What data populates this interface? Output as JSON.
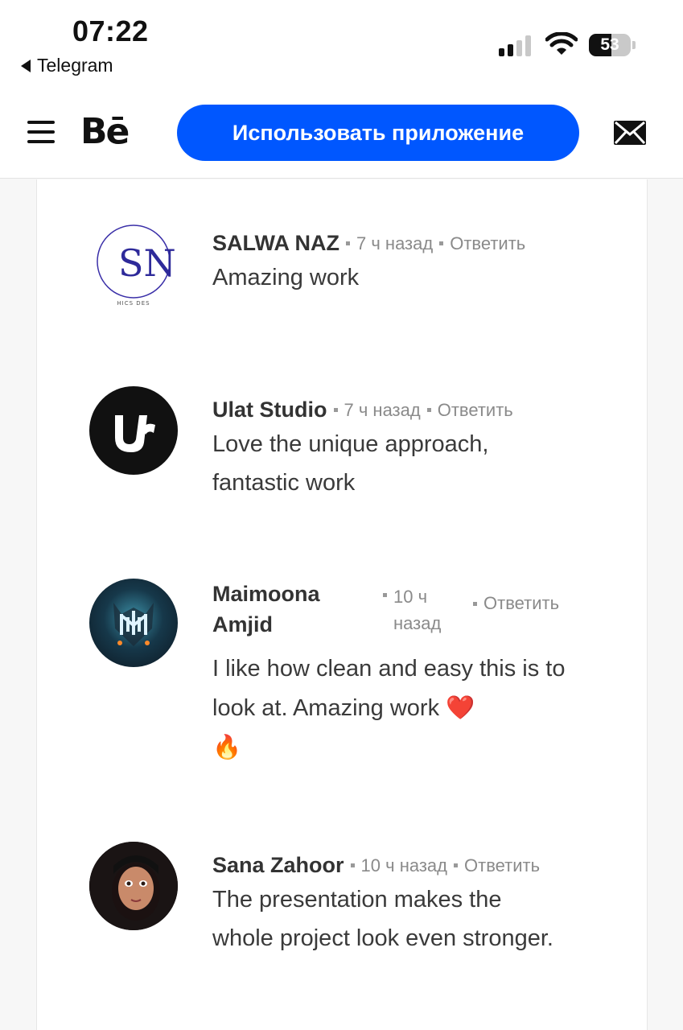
{
  "status_bar": {
    "time": "07:22",
    "back_label": "Telegram",
    "battery_percent": "53",
    "battery_level": 0.53,
    "signal_icon": "cellular-signal-icon",
    "wifi_icon": "wifi-icon"
  },
  "header": {
    "logo": "Bē",
    "app_button_label": "Использовать приложение",
    "menu_icon": "hamburger-menu-icon",
    "mail_icon": "envelope-icon",
    "accent_color": "#0057ff"
  },
  "comments": [
    {
      "name": "SALWA NAZ",
      "time": "7 ч назад",
      "reply_label": "Ответить",
      "text": "Amazing work",
      "avatar_text": "SN",
      "avatar_subtext": "HICS DES"
    },
    {
      "name": "Ulat Studio",
      "time": "7 ч назад",
      "reply_label": "Ответить",
      "text": "Love the unique approach, fantastic work",
      "avatar_text": "U"
    },
    {
      "name": "Maimoona Amjid",
      "time": "10 ч назад",
      "reply_label": "Ответить",
      "text": "I like how clean and easy this is to look at. Amazing work",
      "emoji_1": "❤️",
      "emoji_2": "🔥"
    },
    {
      "name": "Sana Zahoor",
      "time": "10 ч назад",
      "reply_label": "Ответить",
      "text": "The presentation makes the whole project look even stronger."
    }
  ]
}
